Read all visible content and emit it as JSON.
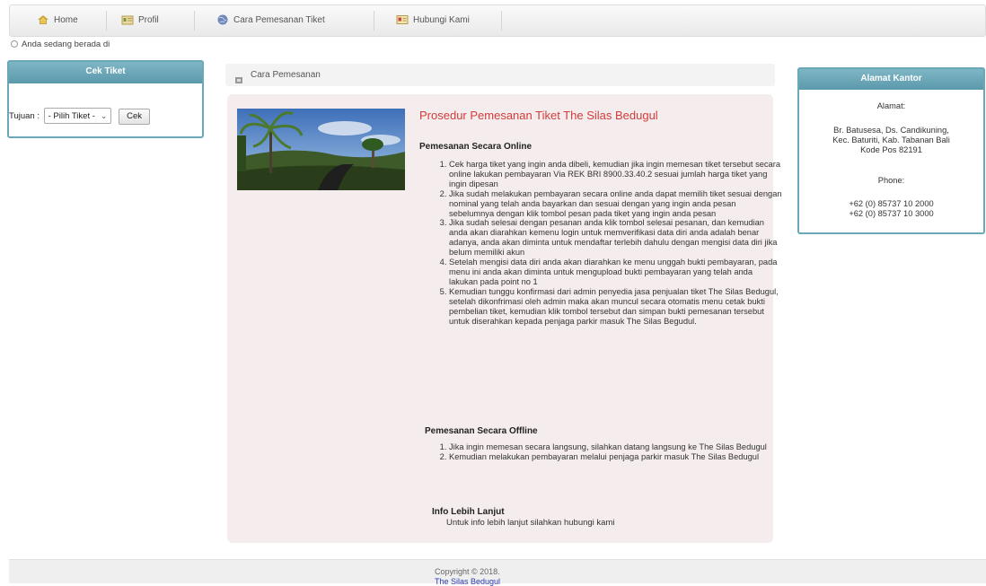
{
  "nav": {
    "items": [
      {
        "label": "Home",
        "icon": "home-icon"
      },
      {
        "label": "Profil",
        "icon": "profile-icon"
      },
      {
        "label": "Cara Pemesanan Tiket",
        "icon": "globe-icon"
      },
      {
        "label": "Hubungi Kami",
        "icon": "contact-icon"
      }
    ]
  },
  "breadcrumb": {
    "text": "Anda sedang berada di"
  },
  "cek_tiket": {
    "title": "Cek Tiket",
    "label": "Tujuan :",
    "select_value": "- Pilih Tiket -",
    "button": "Cek"
  },
  "main": {
    "header": "Cara Pemesanan",
    "title": "Prosedur Pemesanan Tiket The Silas Bedugul",
    "online_heading": "Pemesanan Secara Online",
    "online_steps": [
      "Cek harga tiket yang ingin anda dibeli, kemudian jika ingin memesan tiket tersebut secara online lakukan pembayaran Via REK BRI 8900.33.40.2 sesuai jumlah harga tiket yang ingin dipesan",
      "Jika sudah melakukan pembayaran secara online anda dapat memilih tiket sesuai dengan nominal yang telah anda bayarkan dan sesuai dengan yang ingin anda pesan sebelumnya dengan klik tombol pesan pada tiket yang ingin anda pesan",
      "Jika sudah selesai dengan pesanan anda klik tombol selesai pesanan, dan kemudian anda akan diarahkan kemenu login untuk memverifikasi data diri anda adalah benar adanya, anda akan diminta untuk mendaftar terlebih dahulu dengan mengisi data diri jika belum memiliki akun",
      "Setelah mengisi data diri anda akan diarahkan ke menu unggah bukti pembayaran, pada menu ini anda akan diminta untuk mengupload bukti pembayaran yang telah anda lakukan pada point no 1",
      "Kemudian tunggu konfirmasi dari admin penyedia jasa penjualan tiket The Silas Bedugul, setelah dikonfrimasi oleh admin maka akan muncul secara otomatis menu cetak bukti pembelian tiket, kemudian klik tombol tersebut dan simpan bukti pemesanan tersebut untuk diserahkan kepada penjaga parkir masuk The Silas Begudul."
    ],
    "offline_heading": "Pemesanan Secara Offline",
    "offline_steps": [
      "Jika ingin memesan secara langsung, silahkan datang langsung ke The Silas Bedugul",
      "Kemudian melakukan pembayaran melalui penjaga parkir masuk The Silas Bedugul"
    ],
    "info_heading": "Info Lebih Lanjut",
    "info_text": "Untuk info lebih lanjut silahkan hubungi kami"
  },
  "alamat": {
    "title": "Alamat Kantor",
    "label_alamat": "Alamat:",
    "address_lines": [
      "Br. Batusesa, Ds. Candikuning,",
      "Kec. Baturiti, Kab. Tabanan Bali",
      "Kode Pos 82191"
    ],
    "label_phone": "Phone:",
    "phones": [
      "+62 (0) 85737 10 2000",
      "+62 (0) 85737 10 3000"
    ]
  },
  "footer": {
    "copyright": "Copyright © 2018.",
    "site": "The Silas Bedugul"
  },
  "colors": {
    "accent": "#6aa7b7",
    "title_red": "#d23b3b",
    "content_bg": "#f5eded"
  }
}
